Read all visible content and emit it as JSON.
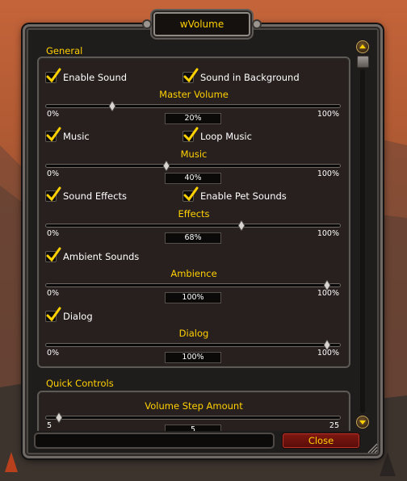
{
  "window": {
    "title": "wVolume"
  },
  "general": {
    "title": "General",
    "enable_sound": "Enable Sound",
    "sound_in_background": "Sound in Background",
    "master": {
      "title": "Master Volume",
      "min": "0%",
      "max": "100%",
      "value": "20%",
      "fraction": 0.2
    },
    "music_cb": "Music",
    "loop_music": "Loop Music",
    "music": {
      "title": "Music",
      "min": "0%",
      "max": "100%",
      "value": "40%",
      "fraction": 0.4
    },
    "sound_effects": "Sound Effects",
    "enable_pet_sounds": "Enable Pet Sounds",
    "effects": {
      "title": "Effects",
      "min": "0%",
      "max": "100%",
      "value": "68%",
      "fraction": 0.68
    },
    "ambient_sounds": "Ambient Sounds",
    "ambience": {
      "title": "Ambience",
      "min": "0%",
      "max": "100%",
      "value": "100%",
      "fraction": 1.0
    },
    "dialog_cb": "Dialog",
    "dialog": {
      "title": "Dialog",
      "min": "0%",
      "max": "100%",
      "value": "100%",
      "fraction": 1.0
    }
  },
  "quick": {
    "title": "Quick Controls",
    "step": {
      "title": "Volume Step Amount",
      "min": "5",
      "max": "25",
      "value": "5",
      "fraction": 0.0
    }
  },
  "footer": {
    "close_label": "Close"
  },
  "icons": {
    "checkmark": "checkmark-icon",
    "scroll_up": "scroll-up-icon",
    "scroll_down": "scroll-down-icon",
    "resize": "resize-grip-icon"
  },
  "colors": {
    "gold": "#ffd100",
    "close_red": "#7e1711"
  }
}
